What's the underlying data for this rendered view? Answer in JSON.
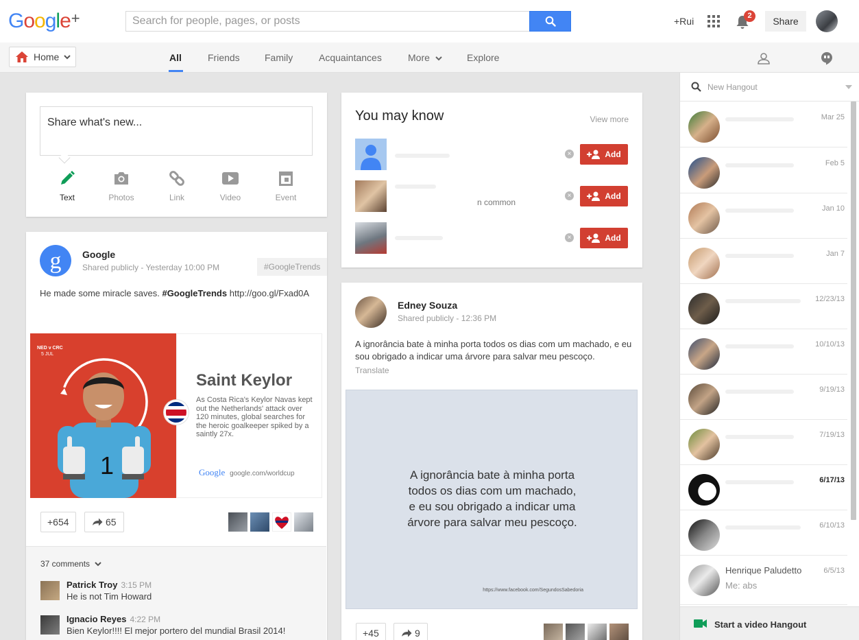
{
  "brand": {
    "logo_letters": [
      "G",
      "o",
      "o",
      "g",
      "l",
      "e"
    ],
    "logo_plus": "+",
    "colors": [
      "#4285f4",
      "#db4437",
      "#f4b400",
      "#4285f4",
      "#0f9d58",
      "#db4437"
    ]
  },
  "search": {
    "placeholder": "Search for people, pages, or posts",
    "button_icon": "search-icon"
  },
  "header": {
    "user": "+Rui",
    "notifications_count": "2",
    "share_label": "Share"
  },
  "nav": {
    "home_label": "Home",
    "tabs": [
      {
        "label": "All",
        "active": true
      },
      {
        "label": "Friends"
      },
      {
        "label": "Family"
      },
      {
        "label": "Acquaintances"
      },
      {
        "label": "More"
      },
      {
        "label": "Explore"
      }
    ]
  },
  "share_box": {
    "prompt": "Share what's new...",
    "tools": [
      {
        "label": "Text",
        "icon": "pencil-icon"
      },
      {
        "label": "Photos",
        "icon": "camera-icon"
      },
      {
        "label": "Link",
        "icon": "link-icon"
      },
      {
        "label": "Video",
        "icon": "video-icon"
      },
      {
        "label": "Event",
        "icon": "calendar-icon"
      }
    ]
  },
  "google_post": {
    "author": "Google",
    "visibility": "Shared publicly",
    "time": "Yesterday 10:00 PM",
    "hashtag_chip": "#GoogleTrends",
    "text_plain": "He made some miracle saves.",
    "text_hashtag": "#GoogleTrends",
    "text_link": "http://goo.gl/Fxad0A",
    "image": {
      "match": "NED v CRC",
      "date": "5 JUL",
      "title": "Saint Keylor",
      "description": "As Costa Rica's Keylor Navas kept out the Netherlands' attack over 120 minutes, global searches for the heroic goalkeeper spiked by a saintly 27x.",
      "footer_logo": "Google",
      "footer_url": "google.com/worldcup"
    },
    "plus_count": "+654",
    "reshare_count": "65",
    "comments_label": "37 comments",
    "comments": [
      {
        "name": "Patrick Troy",
        "time": "3:15 PM",
        "text": "He is not Tim Howard"
      },
      {
        "name": "Ignacio Reyes",
        "time": "4:22 PM",
        "text": "Bien Keylor!!!! El mejor portero del mundial Brasil 2014!"
      }
    ]
  },
  "you_may_know": {
    "title": "You may know",
    "view_more": "View more",
    "add_label": "Add",
    "rows": [
      {
        "sub": ""
      },
      {
        "sub": "n common"
      },
      {
        "sub": ""
      }
    ]
  },
  "edney_post": {
    "author": "Edney Souza",
    "visibility": "Shared publicly",
    "time": "12:36 PM",
    "text": "A ignorância bate à minha porta todos os dias com um machado, e eu sou obrigado a indicar uma árvore para salvar meu pescoço.",
    "translate": "Translate",
    "quote_lines": [
      "A ignorância bate à minha porta",
      "todos os dias com um machado,",
      "e eu sou obrigado a indicar uma",
      "árvore para salvar meu pescoço."
    ],
    "quote_url": "https://www.facebook.com/SegundosSabedoria",
    "plus_count": "+45",
    "reshare_count": "9"
  },
  "hangouts": {
    "search_placeholder": "New Hangout",
    "conversations": [
      {
        "date": "Mar 25",
        "name": "",
        "msg": ""
      },
      {
        "date": "Feb 5",
        "name": "",
        "msg": ""
      },
      {
        "date": "Jan 10",
        "name": "",
        "msg": ""
      },
      {
        "date": "Jan 7",
        "name": "",
        "msg": ""
      },
      {
        "date": "12/23/13",
        "name": "",
        "msg": ""
      },
      {
        "date": "10/10/13",
        "name": "",
        "msg": ""
      },
      {
        "date": "9/19/13",
        "name": "",
        "msg": ""
      },
      {
        "date": "7/19/13",
        "name": "",
        "msg": ""
      },
      {
        "date": "6/17/13",
        "name": "",
        "msg": "",
        "unread": true
      },
      {
        "date": "6/10/13",
        "name": "",
        "msg": ""
      },
      {
        "date": "6/5/13",
        "name": "Henrique Paludetto",
        "msg": "Me: abs"
      }
    ],
    "start_video": "Start a video Hangout"
  }
}
